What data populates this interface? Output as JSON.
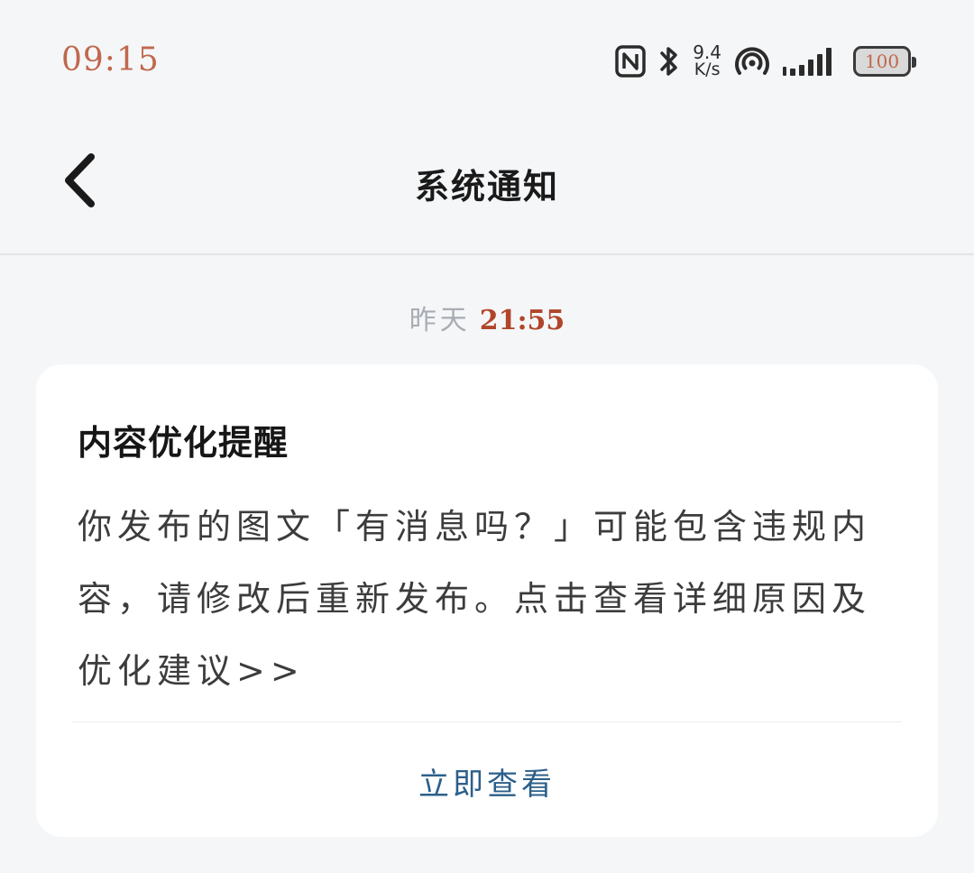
{
  "status_bar": {
    "time": "09:15",
    "net_speed_value": "9.4",
    "net_speed_unit": "K/s",
    "battery": "100",
    "icons": [
      "nfc-icon",
      "bluetooth-icon",
      "hotspot-icon",
      "signal-icon",
      "battery-icon"
    ]
  },
  "header": {
    "title": "系统通知",
    "back_icon": "chevron-left-icon"
  },
  "message": {
    "timestamp_day": "昨天",
    "timestamp_time": "21:55",
    "title": "内容优化提醒",
    "body": "你发布的图文「有消息吗？」可能包含违规内容，请修改后重新发布。点击查看详细原因及优化建议>>",
    "action_label": "立即查看"
  },
  "colors": {
    "background": "#f5f6f8",
    "card": "#ffffff",
    "accent_link": "#2c5f8a",
    "status_time": "#c0684e"
  }
}
